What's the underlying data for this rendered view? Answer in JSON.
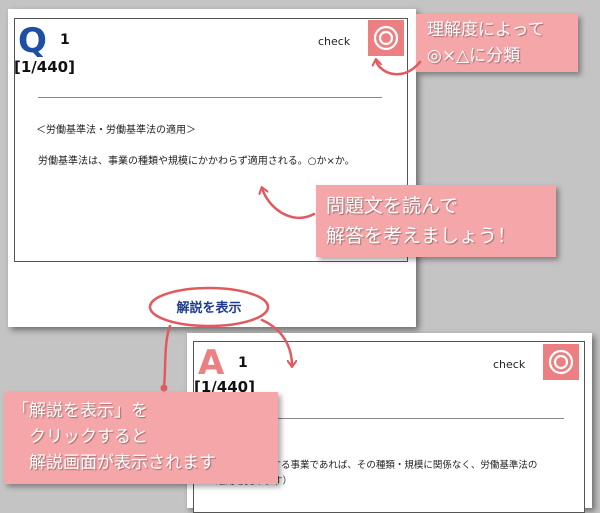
{
  "question_card": {
    "letter": "Q",
    "number": "1",
    "counter": "[1/440]",
    "check_label": "check",
    "category": "＜労働基準法・労働基準法の適用＞",
    "question_text": "労働基準法は、事業の種類や規模にかかわらず適用される。○か×か。"
  },
  "show_explanation": {
    "label": "解説を表示"
  },
  "answer_card": {
    "letter": "A",
    "number": "1",
    "counter": "[1/440]",
    "check_label": "check",
    "answer_line1": "用する事業であれば、その種類・規模に関係なく、労働基準法の",
    "answer_line2": "適用を受けます）"
  },
  "callouts": {
    "classify": "理解度によって\n◎×△に分類",
    "read": "問題文を読んで\n解答を考えましょう！",
    "click": "「解説を表示」を\n　クリックすると\n　解説画面が表示されます"
  },
  "colors": {
    "accent_pink": "#ec7f81",
    "callout_pink": "#f4a6a8",
    "q_blue": "#1e4fa3",
    "link_blue": "#1f3d8f"
  },
  "icons": {
    "check_button": "double-circle-icon",
    "arrows": "curved-arrow-icon"
  }
}
